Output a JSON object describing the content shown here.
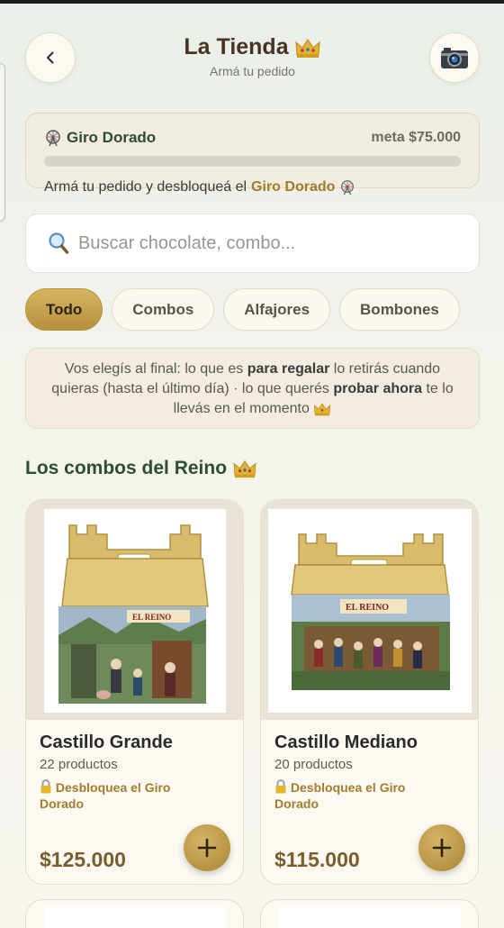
{
  "header": {
    "title": "La Tienda",
    "subtitle": "Armá tu pedido"
  },
  "giro": {
    "name": "Giro Dorado",
    "goal_label": "meta $75.000",
    "progress": 0.0,
    "message_prefix": "Armá tu pedido y desbloqueá el",
    "message_highlight": "Giro Dorado"
  },
  "search": {
    "placeholder": "Buscar chocolate, combo..."
  },
  "categories": [
    "Todo",
    "Combos",
    "Alfajores",
    "Bombones"
  ],
  "active_category": "Todo",
  "notice": {
    "part1": "Vos elegís al final: lo que es",
    "bold1": "para regalar",
    "part2": "lo retirás cuando quieras (hasta el último día) · lo que querés",
    "bold2": "probar ahora",
    "part3": "te lo llevás en el momento"
  },
  "section": {
    "title": "Los combos del Reino"
  },
  "products": [
    {
      "name": "Castillo Grande",
      "count": "22 productos",
      "lock_text": "Desbloquea el Giro Dorado",
      "price": "$125.000",
      "box_brand": "EL REINO"
    },
    {
      "name": "Castillo Mediano",
      "count": "20 productos",
      "lock_text": "Desbloquea el Giro Dorado",
      "price": "$115.000",
      "box_brand": "EL REINO"
    }
  ],
  "colors": {
    "accent_gold": "#c8a24a",
    "title_brown": "#4a3420",
    "section_green": "#2f4e3a"
  },
  "icons": {
    "back": "chevron-left-icon",
    "camera": "camera-icon",
    "crown": "crown-icon",
    "ferris_wheel": "ferris-wheel-icon",
    "search": "magnifier-icon",
    "lock": "lock-icon",
    "add": "plus-icon"
  }
}
